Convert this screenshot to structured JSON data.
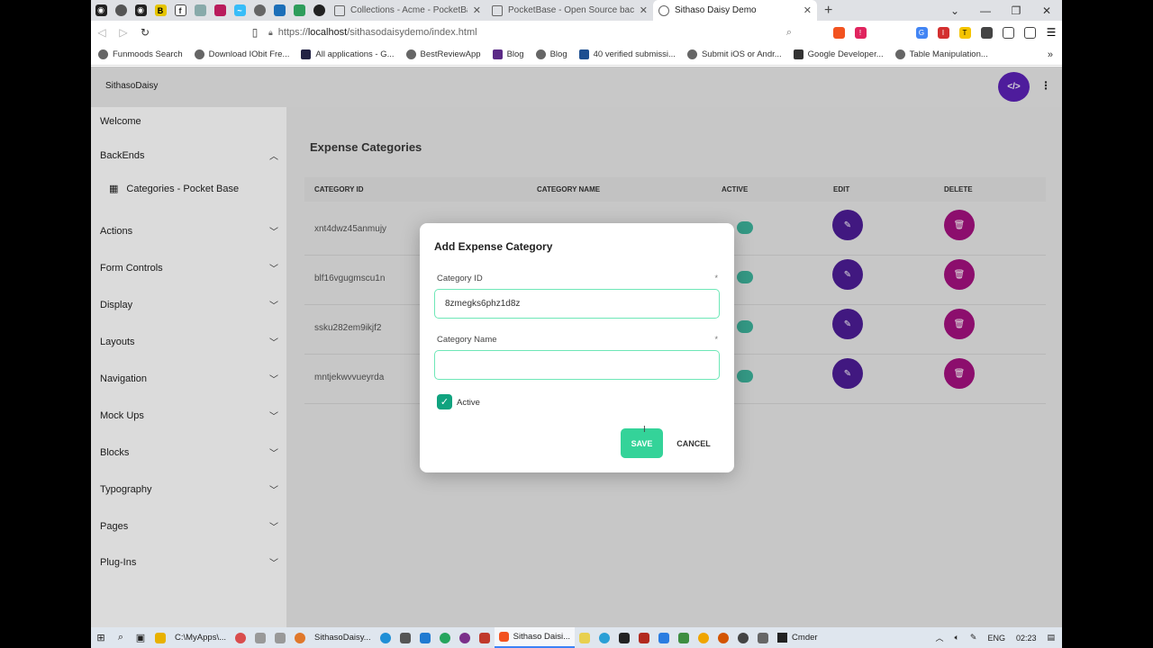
{
  "browser": {
    "tabs": [
      {
        "title": "Collections - Acme - PocketBase",
        "active": false
      },
      {
        "title": "PocketBase - Open Source backend in",
        "active": false
      },
      {
        "title": "Sithaso Daisy Demo",
        "active": true
      }
    ],
    "address": {
      "prefix": "https://",
      "host": "localhost",
      "path": "/sithasodaisydemo/index.html"
    },
    "bookmarks": [
      "Funmoods Search",
      "Download IObit Fre...",
      "All applications - G...",
      "BestReviewApp",
      "Blog",
      "Blog",
      "40 verified submissi...",
      "Submit iOS or Andr...",
      "Google Developer...",
      "Table Manipulation..."
    ]
  },
  "app": {
    "brand": "SithasoDaisy",
    "sidebar": {
      "welcome": "Welcome",
      "backends": "BackEnds",
      "sub_item": "Categories - Pocket Base",
      "items": [
        "Actions",
        "Form Controls",
        "Display",
        "Layouts",
        "Navigation",
        "Mock Ups",
        "Blocks",
        "Typography",
        "Pages",
        "Plug-Ins"
      ]
    },
    "page_title": "Expense Categories",
    "table": {
      "headers": [
        "CATEGORY ID",
        "CATEGORY NAME",
        "ACTIVE",
        "EDIT",
        "DELETE"
      ],
      "rows": [
        {
          "id": "xnt4dwz45anmujy"
        },
        {
          "id": "blf16vgugmscu1n"
        },
        {
          "id": "ssku282em9ikjf2"
        },
        {
          "id": "mntjekwvvueyrda"
        }
      ]
    },
    "modal": {
      "title": "Add Expense Category",
      "field1_label": "Category ID",
      "field1_value": "8zmegks6phz1d8z",
      "field2_label": "Category Name",
      "field2_value": "",
      "required_mark": "*",
      "active_label": "Active",
      "save_label": "SAVE",
      "cancel_label": "CANCEL"
    }
  },
  "taskbar": {
    "apps": [
      "C:\\MyApps\\...",
      "SithasoDaisy...",
      "Sithaso Daisi...",
      "Cmder"
    ],
    "lang": "ENG",
    "time": "02:23"
  },
  "colors": {
    "accent_purple": "#5b21b6",
    "accent_magenta": "#a3117f",
    "accent_green": "#34d399"
  }
}
